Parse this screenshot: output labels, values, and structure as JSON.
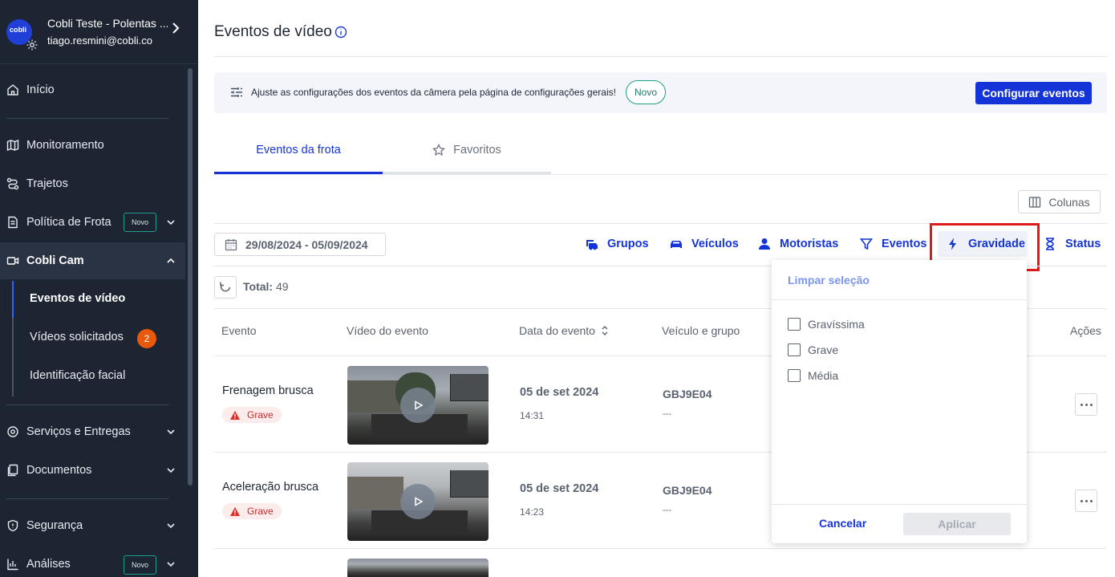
{
  "sidebar": {
    "org_name": "Cobli Teste - Polentas ...",
    "user_email": "tiago.resmini@cobli.co",
    "logo_text": "cobli",
    "items": [
      {
        "label": "Início",
        "icon": "home-icon"
      },
      {
        "label": "Monitoramento",
        "icon": "map-icon"
      },
      {
        "label": "Trajetos",
        "icon": "route-icon"
      },
      {
        "label": "Política de Frota",
        "icon": "document-icon",
        "badge": "Novo"
      },
      {
        "label": "Cobli Cam",
        "icon": "camera-icon"
      },
      {
        "label": "Serviços e Entregas",
        "icon": "location-icon"
      },
      {
        "label": "Documentos",
        "icon": "documents-icon"
      },
      {
        "label": "Segurança",
        "icon": "shield-icon"
      },
      {
        "label": "Análises",
        "icon": "chart-icon",
        "badge": "Novo"
      }
    ],
    "cam_sub": [
      {
        "label": "Eventos de vídeo"
      },
      {
        "label": "Vídeos solicitados",
        "count": "2"
      },
      {
        "label": "Identificação facial"
      }
    ]
  },
  "page": {
    "title": "Eventos de vídeo"
  },
  "banner": {
    "text": "Ajuste as configurações dos eventos da câmera pela página de configurações gerais!",
    "badge": "Novo",
    "button": "Configurar eventos"
  },
  "tabs": [
    {
      "label": "Eventos da frota",
      "active": true
    },
    {
      "label": "Favoritos",
      "active": false
    }
  ],
  "toolbar": {
    "columns_label": "Colunas",
    "date_range": "29/08/2024 - 05/09/2024",
    "filters": [
      "Grupos",
      "Veículos",
      "Motoristas",
      "Eventos",
      "Gravidade",
      "Status"
    ],
    "total_label": "Total:",
    "total_value": "49"
  },
  "table": {
    "headers": [
      "Evento",
      "Vídeo do evento",
      "Data do evento",
      "Veículo e grupo",
      "Ações"
    ],
    "rows": [
      {
        "event": "Frenagem brusca",
        "severity": "Grave",
        "date": "05 de set 2024",
        "time": "14:31",
        "plate": "GBJ9E04",
        "group": "---"
      },
      {
        "event": "Aceleração brusca",
        "severity": "Grave",
        "date": "05 de set 2024",
        "time": "14:23",
        "plate": "GBJ9E04",
        "group": "---"
      }
    ]
  },
  "severity_dropdown": {
    "clear_label": "Limpar seleção",
    "options": [
      "Gravíssima",
      "Grave",
      "Média"
    ],
    "cancel_label": "Cancelar",
    "apply_label": "Aplicar"
  },
  "colors": {
    "sidebar_bg": "#1d2533",
    "primary": "#1434d8",
    "severity_red": "#c92a2a",
    "badge_teal": "#1f9d8b",
    "highlight_red": "#e01a1a"
  }
}
